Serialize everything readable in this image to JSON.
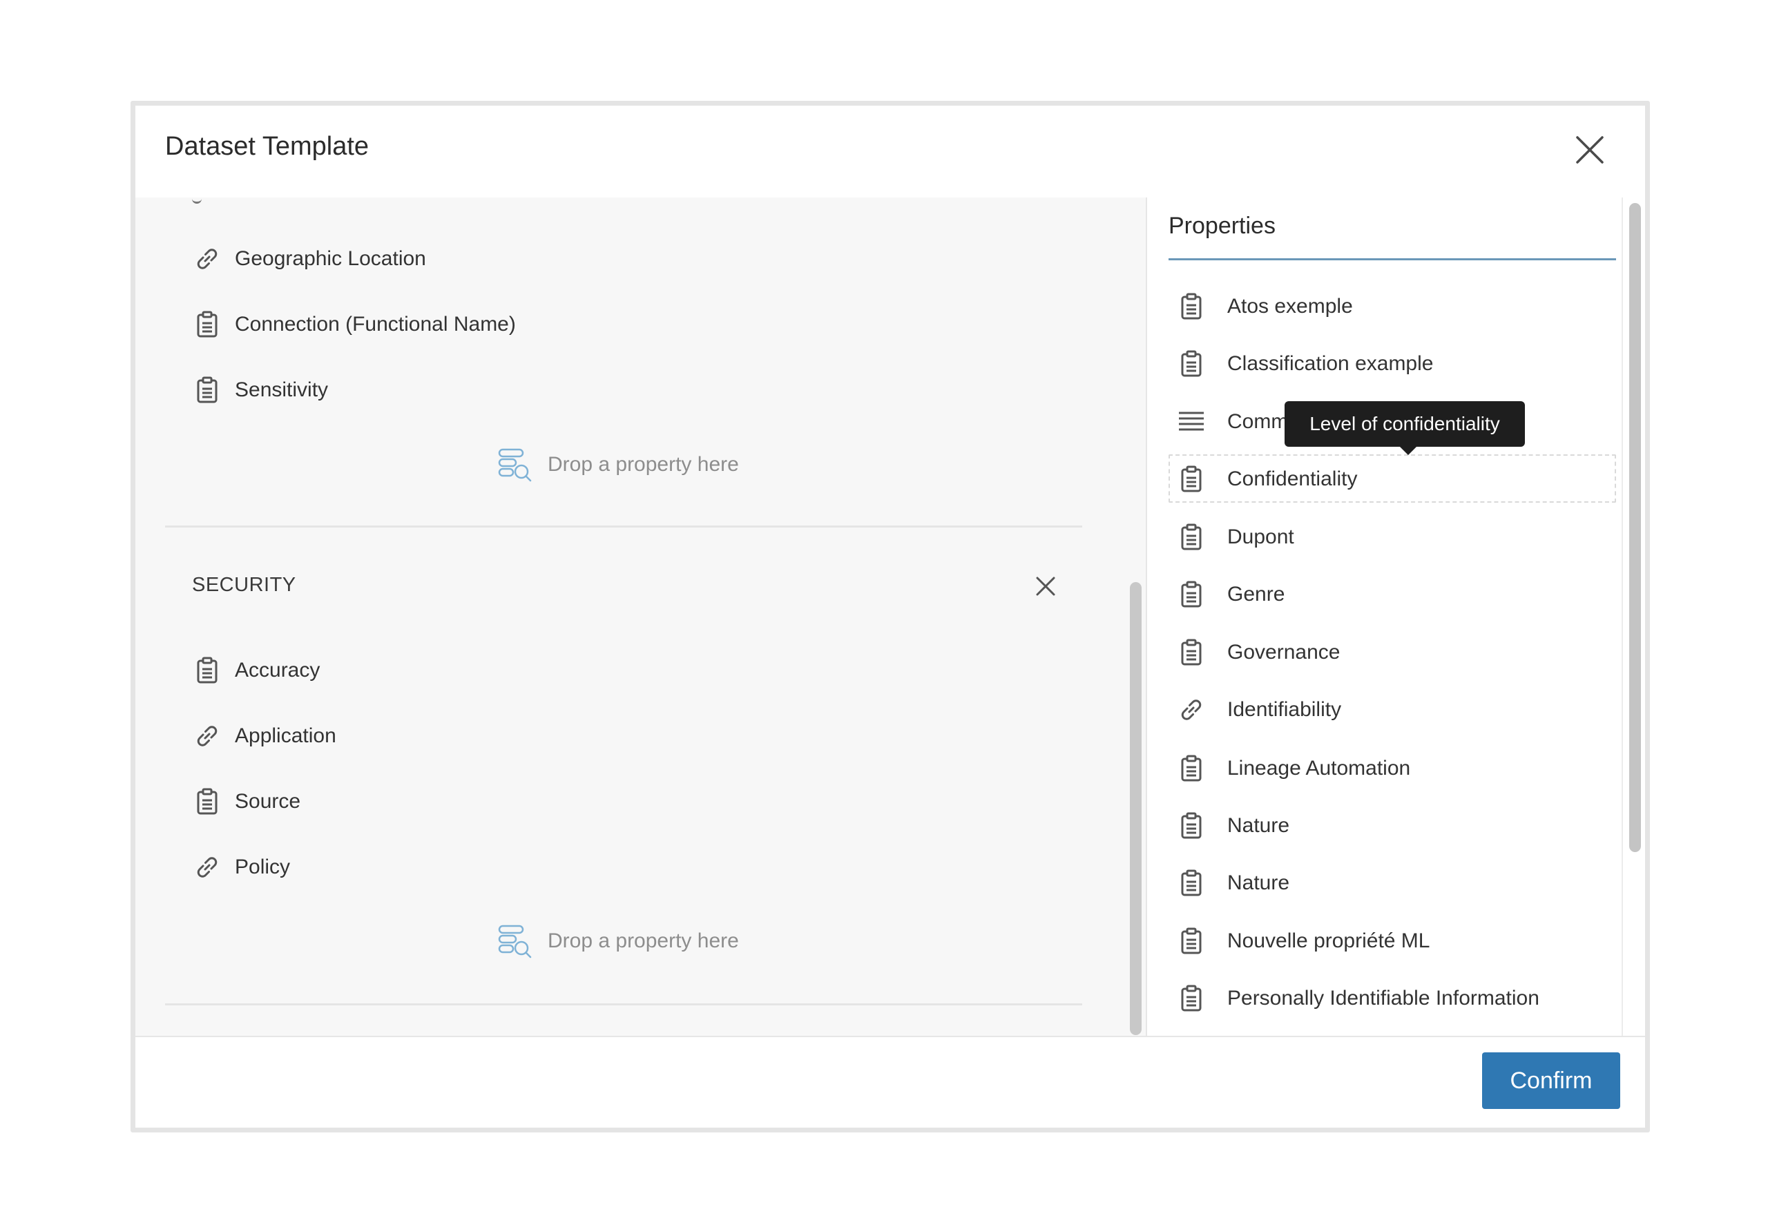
{
  "modal": {
    "title": "Dataset Template",
    "confirm_label": "Confirm"
  },
  "left": {
    "items_top": [
      {
        "label": "Geographic Location",
        "icon": "link-icon"
      },
      {
        "label": "Connection (Functional Name)",
        "icon": "clipboard-icon"
      },
      {
        "label": "Sensitivity",
        "icon": "clipboard-icon"
      }
    ],
    "drop_label_1": "Drop a property here",
    "security": {
      "title": "SECURITY",
      "items": [
        {
          "label": "Accuracy",
          "icon": "clipboard-icon"
        },
        {
          "label": "Application",
          "icon": "link-icon"
        },
        {
          "label": "Source",
          "icon": "clipboard-icon"
        },
        {
          "label": "Policy",
          "icon": "link-icon"
        }
      ],
      "drop_label": "Drop a property here"
    }
  },
  "properties": {
    "title": "Properties",
    "items": [
      {
        "label": "Atos exemple",
        "icon": "clipboard-icon"
      },
      {
        "label": "Classification example",
        "icon": "clipboard-icon"
      },
      {
        "label": "Comme",
        "icon": "list-lines-icon"
      },
      {
        "label": "Confidentiality",
        "icon": "clipboard-icon"
      },
      {
        "label": "Dupont",
        "icon": "clipboard-icon"
      },
      {
        "label": "Genre",
        "icon": "clipboard-icon"
      },
      {
        "label": "Governance",
        "icon": "clipboard-icon"
      },
      {
        "label": "Identifiability",
        "icon": "link-icon"
      },
      {
        "label": "Lineage Automation",
        "icon": "clipboard-icon"
      },
      {
        "label": "Nature",
        "icon": "clipboard-icon"
      },
      {
        "label": "Nature",
        "icon": "clipboard-icon"
      },
      {
        "label": "Nouvelle propriété ML",
        "icon": "clipboard-icon"
      },
      {
        "label": "Personally Identifiable Information",
        "icon": "clipboard-icon"
      }
    ],
    "tooltip": "Level of confidentiality"
  }
}
